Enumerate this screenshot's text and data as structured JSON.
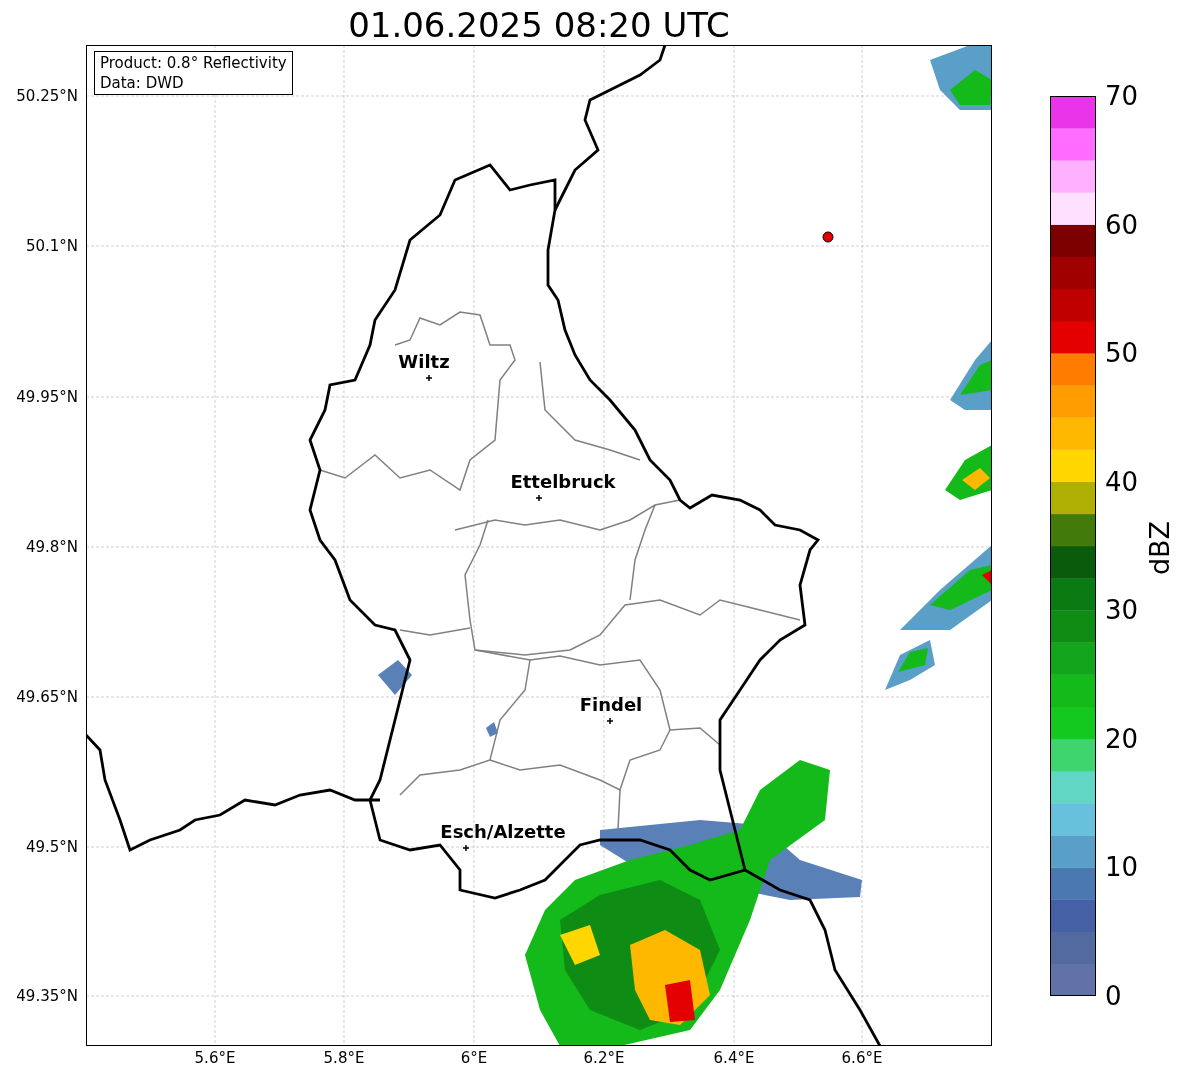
{
  "title": "01.06.2025 08:20 UTC",
  "legend": [
    "Product: 0.8° Reflectivity",
    "Data: DWD"
  ],
  "y_ticks": [
    "50.25°N",
    "50.1°N",
    "49.95°N",
    "49.8°N",
    "49.65°N",
    "49.5°N",
    "49.35°N"
  ],
  "x_ticks": [
    "5.6°E",
    "5.8°E",
    "6°E",
    "6.2°E",
    "6.4°E",
    "6.6°E"
  ],
  "cities": [
    {
      "name": "Wiltz"
    },
    {
      "name": "Ettelbruck"
    },
    {
      "name": "Findel"
    },
    {
      "name": "Esch/Alzette"
    }
  ],
  "colorbar": {
    "label": "dBZ",
    "ticks": [
      "70",
      "60",
      "50",
      "40",
      "30",
      "20",
      "10",
      "0"
    ],
    "segments": [
      {
        "color": "#6272a8"
      },
      {
        "color": "#536aa0"
      },
      {
        "color": "#4560a5"
      },
      {
        "color": "#4a78b0"
      },
      {
        "color": "#5a9fc8"
      },
      {
        "color": "#67c0dc"
      },
      {
        "color": "#62d6c4"
      },
      {
        "color": "#3ed46e"
      },
      {
        "color": "#13c81e"
      },
      {
        "color": "#14b91a"
      },
      {
        "color": "#12a41a"
      },
      {
        "color": "#0e8c14"
      },
      {
        "color": "#0a7a12"
      },
      {
        "color": "#0a5c0c"
      },
      {
        "color": "#437a0c"
      },
      {
        "color": "#b0b004"
      },
      {
        "color": "#ffd600"
      },
      {
        "color": "#ffb800"
      },
      {
        "color": "#ff9c00"
      },
      {
        "color": "#ff7c00"
      },
      {
        "color": "#e40000"
      },
      {
        "color": "#c00000"
      },
      {
        "color": "#a00000"
      },
      {
        "color": "#7c0000"
      },
      {
        "color": "#ffe0ff"
      },
      {
        "color": "#ffb0ff"
      },
      {
        "color": "#ff6cff"
      },
      {
        "color": "#ea34ea"
      }
    ]
  }
}
